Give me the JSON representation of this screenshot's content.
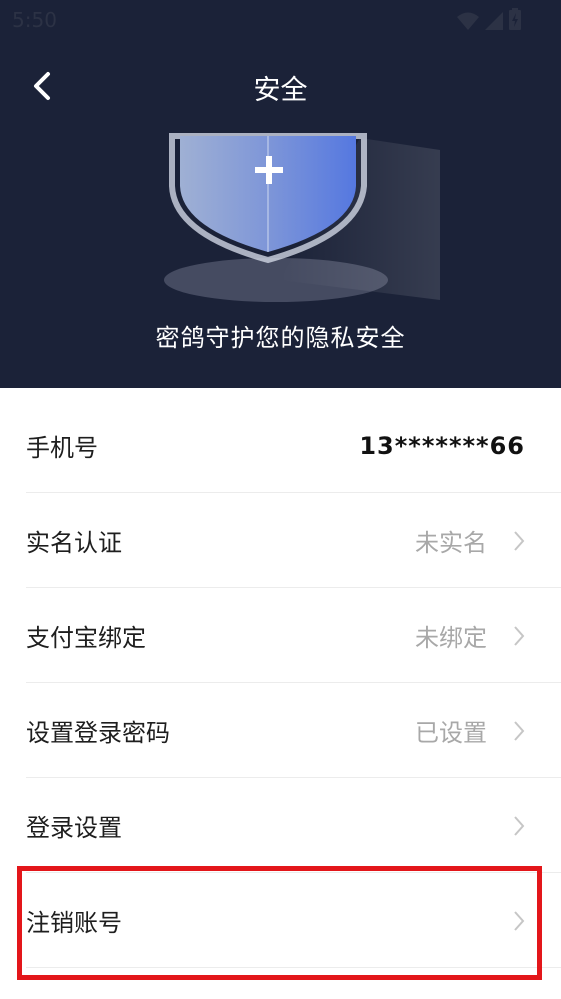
{
  "status": {
    "time": "5:50"
  },
  "nav": {
    "title": "安全"
  },
  "banner": {
    "caption": "密鸽守护您的隐私安全"
  },
  "rows": [
    {
      "label": "手机号",
      "value": "13*******66"
    },
    {
      "label": "实名认证",
      "value": "未实名"
    },
    {
      "label": "支付宝绑定",
      "value": "未绑定"
    },
    {
      "label": "设置登录密码",
      "value": "已设置"
    },
    {
      "label": "登录设置",
      "value": ""
    },
    {
      "label": "注销账号",
      "value": ""
    }
  ],
  "colors": {
    "header_bg": "#1b2238",
    "highlight": "#e3161a",
    "value_muted": "#a8a8a8"
  },
  "icons": [
    "back-arrow-icon",
    "shield-plus-icon",
    "chevron-right-icon",
    "wifi-icon",
    "signal-icon",
    "battery-icon"
  ]
}
